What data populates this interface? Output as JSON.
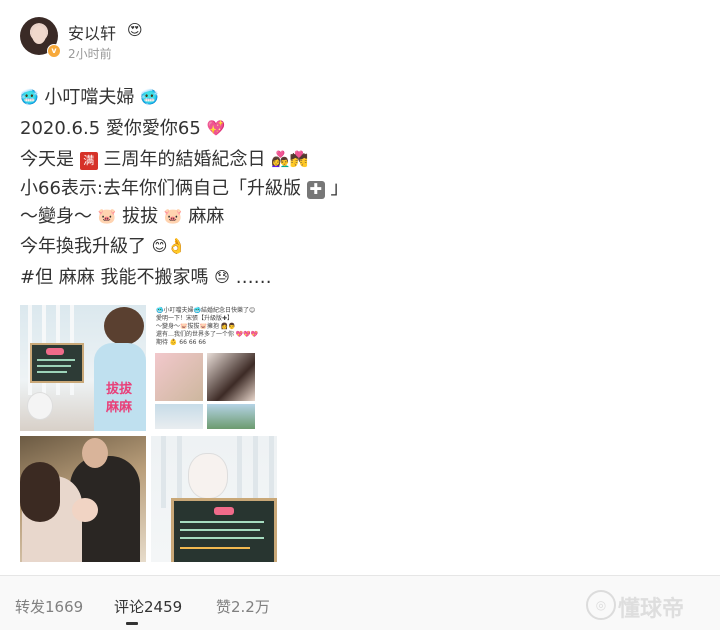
{
  "header": {
    "user_name": "安以轩",
    "time": "2小时前",
    "verified_badge": "v",
    "vip_icon": "crown-badge-icon"
  },
  "post": {
    "line1": {
      "pre": "🥶",
      "text": "小叮噹夫婦",
      "post": "🥶"
    },
    "line2": {
      "text": "2020.6.5 愛你愛你65",
      "post": "💖"
    },
    "line3": {
      "pre": "今天是",
      "box": "满",
      "text": "三周年的結婚紀念日",
      "post": "👩‍❤️‍👨💏"
    },
    "line4": {
      "text": "小66表示:去年你们俩自己「升級版",
      "plus": "✚",
      "post": "」"
    },
    "line5": {
      "pre": "～變身～",
      "e1": "🐷",
      "mid": "拔拔",
      "e2": "🐷",
      "text": "麻麻"
    },
    "line6": {
      "text": "今年換我升級了",
      "post": "😊👌"
    },
    "line7": {
      "text": "#但 麻麻 我能不搬家嗎",
      "emoji": "😓",
      "post": "……"
    }
  },
  "images": {
    "img1_caption": "拔拔 麻麻",
    "img2_lines": [
      "🥶小叮噹夫婦🥶結婚紀念日快樂了😊",
      "愛明一下！宋張【升級版✚】",
      "～變身～🐷拔拔🐷擁抱 👩👨",
      "還有…我们的世界多了一个你 💖💖💖",
      "期待 👶 66 66 66"
    ]
  },
  "footer": {
    "repost": "转发1669",
    "comment": "评论2459",
    "like": "赞2.2万",
    "watermark": "懂球帝"
  }
}
